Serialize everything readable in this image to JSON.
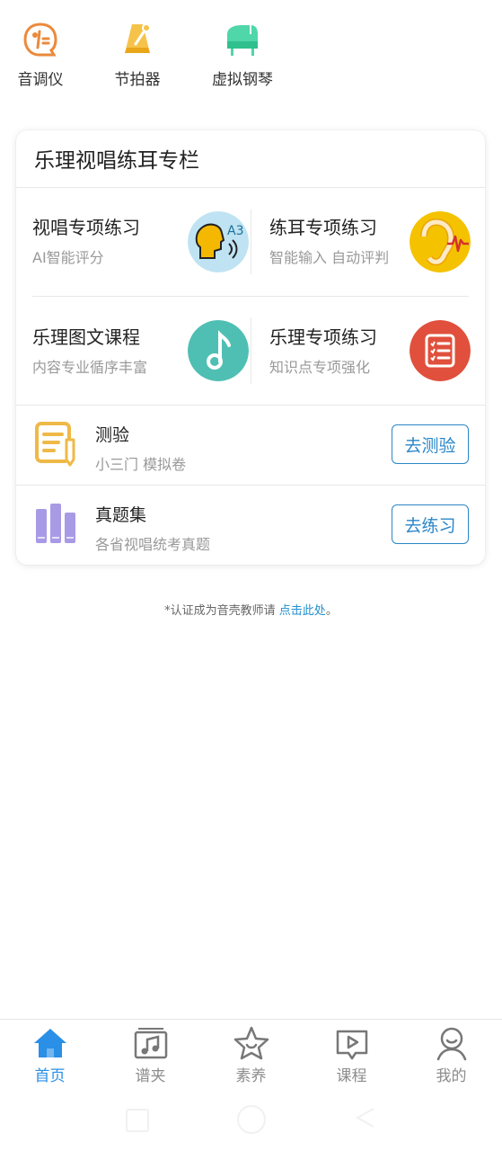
{
  "tools": [
    {
      "label": "音调仪",
      "icon": "tuner-icon"
    },
    {
      "label": "节拍器",
      "icon": "metronome-icon"
    },
    {
      "label": "虚拟钢琴",
      "icon": "piano-icon"
    }
  ],
  "card": {
    "title": "乐理视唱练耳专栏",
    "cells": [
      {
        "title": "视唱专项练习",
        "sub": "AI智能评分",
        "icon": "sight-singing-icon"
      },
      {
        "title": "练耳专项练习",
        "sub": "智能输入 自动评判",
        "icon": "ear-training-icon"
      },
      {
        "title": "乐理图文课程",
        "sub": "内容专业循序丰富",
        "icon": "music-note-icon"
      },
      {
        "title": "乐理专项练习",
        "sub": "知识点专项强化",
        "icon": "list-icon"
      }
    ],
    "rows": [
      {
        "title": "测验",
        "sub": "小三门 模拟卷",
        "button": "去测验",
        "icon": "quiz-icon"
      },
      {
        "title": "真题集",
        "sub": "各省视唱统考真题",
        "button": "去练习",
        "icon": "books-icon"
      }
    ]
  },
  "note": {
    "text": "*认证成为音壳教师请 ",
    "link": "点击此处",
    "suffix": "。"
  },
  "tabs": [
    {
      "label": "首页",
      "icon": "home-icon",
      "active": true
    },
    {
      "label": "谱夹",
      "icon": "score-folder-icon",
      "active": false
    },
    {
      "label": "素养",
      "icon": "star-icon",
      "active": false
    },
    {
      "label": "课程",
      "icon": "video-course-icon",
      "active": false
    },
    {
      "label": "我的",
      "icon": "profile-icon",
      "active": false
    }
  ],
  "colors": {
    "accent": "#2a8fe6",
    "button": "#2a86c8",
    "muted": "#999999"
  }
}
